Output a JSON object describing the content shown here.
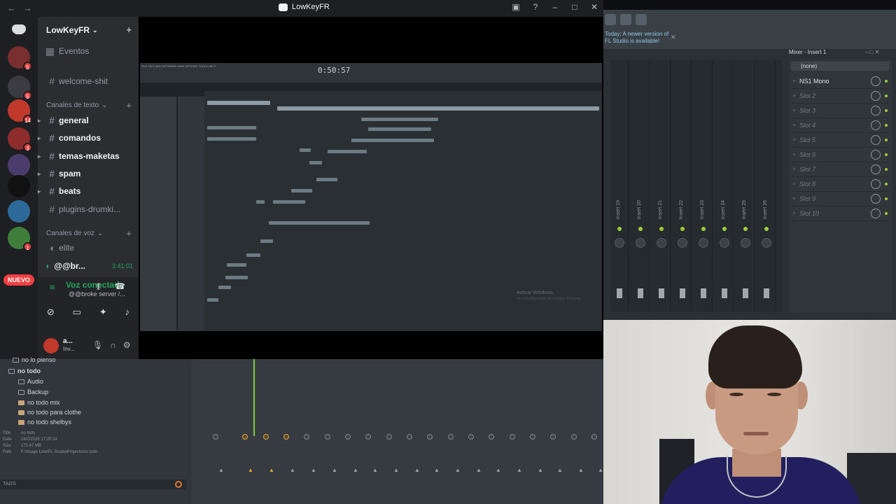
{
  "discord": {
    "window_title": "LowKeyFR",
    "server_name": "LowKeyFR",
    "events_label": "Eventos",
    "pinned_channel": "welcome-shit",
    "text_category": "Canales de texto",
    "text_channels": [
      {
        "name": "general",
        "unread": true
      },
      {
        "name": "comandos",
        "unread": true
      },
      {
        "name": "temas-maketas",
        "unread": true
      },
      {
        "name": "spam",
        "unread": true
      },
      {
        "name": "beats",
        "unread": true
      },
      {
        "name": "plugins-drumki...",
        "unread": false
      }
    ],
    "voice_category": "Canales de voz",
    "voice_channels": [
      {
        "name": "elite"
      }
    ],
    "voice_user": {
      "name": "@@br...",
      "timer": "3:41:01"
    },
    "guild_badges": [
      "5",
      "5",
      "14",
      "3",
      "1"
    ],
    "new_badge": "NUEVO",
    "voice_status": "Voz conectada",
    "voice_server": "@@broke server /...",
    "user_name": "a...",
    "user_status": "Inv..."
  },
  "stream": {
    "time": "0:50:57",
    "watermark": "Activar Windows",
    "watermark_sub": "Ve a Configuración para activar Windows."
  },
  "fl_right": {
    "update_notice_line1": "Today: A newer version of",
    "update_notice_line2": "FL Studio is available!",
    "mixer_title": "Mixer - Insert 1",
    "fx_input": "(none)",
    "strip_labels": [
      "Insert 19",
      "Insert 20",
      "Insert 21",
      "Insert 22",
      "Insert 23",
      "Insert 24",
      "Insert 25",
      "Insert 26"
    ],
    "slots": [
      "NS1 Mono",
      "Slot 2",
      "Slot 3",
      "Slot 4",
      "Slot 5",
      "Slot 6",
      "Slot 7",
      "Slot 8",
      "Slot 9",
      "Slot 10"
    ]
  },
  "browser": {
    "items": [
      {
        "label": "no lo pienso",
        "type": "folder",
        "level": 0
      },
      {
        "label": "no todo",
        "type": "folder-open",
        "level": 0
      },
      {
        "label": "Audio",
        "type": "folder",
        "level": 1
      },
      {
        "label": "Backup",
        "type": "folder",
        "level": 1
      },
      {
        "label": "no todo mix",
        "type": "file",
        "level": 1
      },
      {
        "label": "no todo para clothe",
        "type": "file",
        "level": 1
      },
      {
        "label": "no todo shelbys",
        "type": "file",
        "level": 1
      }
    ],
    "info": [
      {
        "key": "Title",
        "value": "no todo"
      },
      {
        "key": "Date",
        "value": "24/2/2026 17:20:24"
      },
      {
        "key": "Size",
        "value": "172.47 MB"
      },
      {
        "key": "Path",
        "value": "F:\\Image-Line\\FL Studio\\Projects\\no todo"
      }
    ],
    "tags_label": "TAGS"
  },
  "colors": {
    "discord_bg": "#2b2d31",
    "discord_green": "#23a55a",
    "discord_red": "#f23f42",
    "fl_led": "#9ccf38",
    "fl_playhead": "#7dd13a"
  }
}
